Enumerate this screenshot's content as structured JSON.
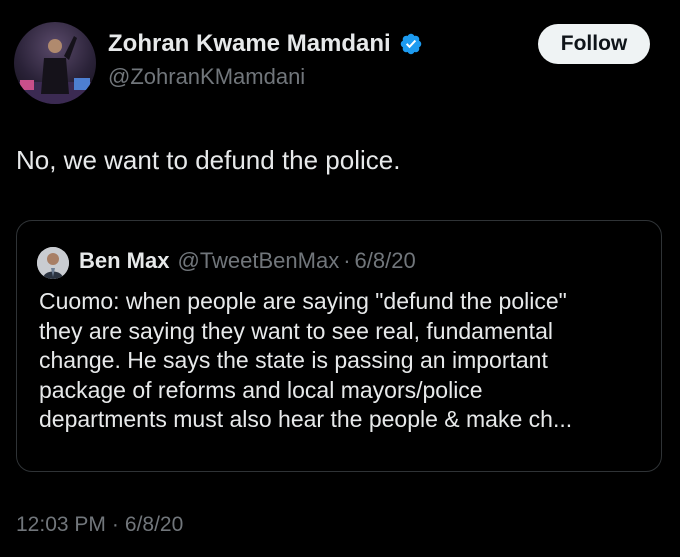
{
  "tweet": {
    "author": {
      "name": "Zohran Kwame Mamdani",
      "handle": "@ZohranKMamdani",
      "verified_icon": "verified-badge-icon"
    },
    "follow_label": "Follow",
    "text": "No, we want to defund the police.",
    "time": "12:03 PM",
    "separator": "·",
    "date": "6/8/20"
  },
  "quote": {
    "author": {
      "name": "Ben Max",
      "handle": "@TweetBenMax"
    },
    "separator": "·",
    "date": "6/8/20",
    "text": "Cuomo: when people are saying \"defund the police\"\nthey are saying they want to see real, fundamental\nchange. He says the state is passing an important\npackage of reforms and local mayors/police\ndepartments must also hear the people & make ch..."
  },
  "colors": {
    "background": "#000000",
    "text_primary": "#e7e9ea",
    "text_secondary": "#71767b",
    "border": "#2f3336",
    "verified_blue": "#1d9bf0",
    "button_bg": "#eff3f4",
    "button_text": "#0f1419"
  }
}
